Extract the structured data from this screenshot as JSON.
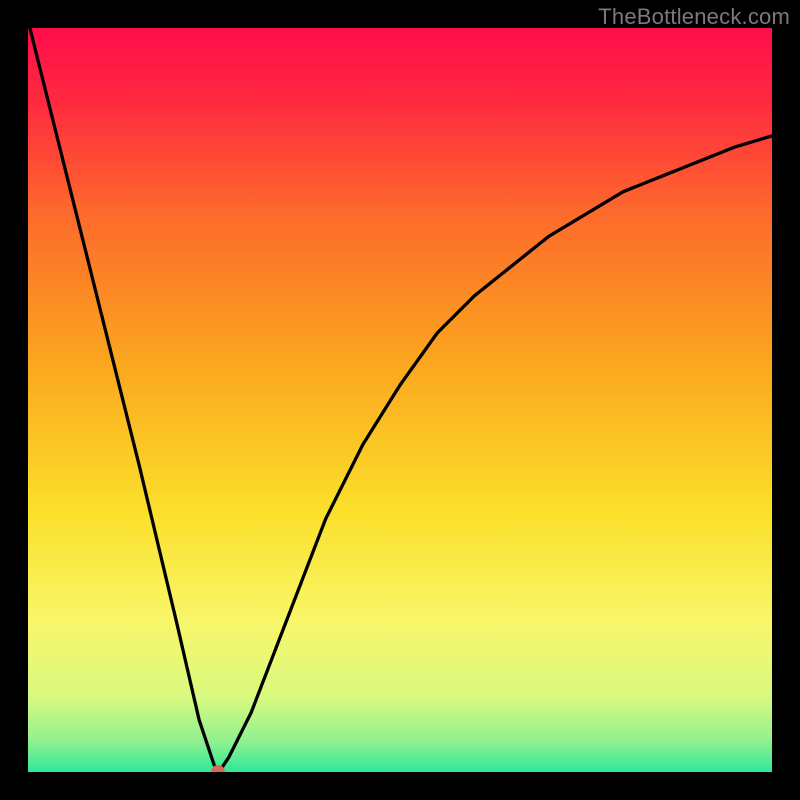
{
  "watermark": "TheBottleneck.com",
  "colors": {
    "frame": "#000000",
    "watermark": "#7a7a7a",
    "curve": "#000000",
    "dot": "#d96a5a",
    "gradient_stops": [
      {
        "pos": 0.0,
        "color": "#ff0d4a"
      },
      {
        "pos": 0.1,
        "color": "#ff2a3f"
      },
      {
        "pos": 0.25,
        "color": "#fd6a2b"
      },
      {
        "pos": 0.45,
        "color": "#fba61f"
      },
      {
        "pos": 0.65,
        "color": "#fbe02a"
      },
      {
        "pos": 0.8,
        "color": "#f9f66a"
      },
      {
        "pos": 0.9,
        "color": "#d8f97f"
      },
      {
        "pos": 0.96,
        "color": "#8ef08e"
      },
      {
        "pos": 1.0,
        "color": "#2de89a"
      }
    ]
  },
  "chart_data": {
    "type": "line",
    "title": "",
    "xlabel": "",
    "ylabel": "",
    "ylim": [
      0,
      100
    ],
    "xlim": [
      0,
      100
    ],
    "x": [
      0,
      5,
      10,
      15,
      20,
      23,
      25,
      25.5,
      26,
      27,
      30,
      35,
      40,
      45,
      50,
      55,
      60,
      65,
      70,
      75,
      80,
      85,
      90,
      95,
      100
    ],
    "values": [
      101,
      81,
      61,
      41,
      20,
      7,
      1,
      0,
      0.5,
      2,
      8,
      21,
      34,
      44,
      52,
      59,
      64,
      68,
      72,
      75,
      78,
      80,
      82,
      84,
      85.5
    ],
    "minimum_marker": {
      "x": 25.5,
      "y": 0
    }
  }
}
